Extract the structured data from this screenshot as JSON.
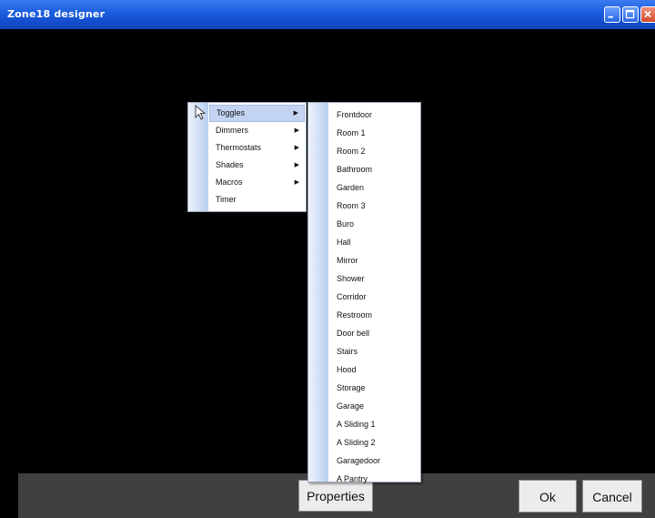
{
  "window": {
    "title": "Zone18 designer"
  },
  "menu1": {
    "items": [
      {
        "label": "Toggles",
        "submenu": true,
        "highlighted": true
      },
      {
        "label": "Dimmers",
        "submenu": true
      },
      {
        "label": "Thermostats",
        "submenu": true
      },
      {
        "label": "Shades",
        "submenu": true
      },
      {
        "label": "Macros",
        "submenu": true
      },
      {
        "label": "Timer",
        "submenu": false
      }
    ]
  },
  "submenu": {
    "items": [
      "Frontdoor",
      "Room 1",
      "Room 2",
      "Bathroom",
      "Garden",
      "Room 3",
      "Buro",
      "Hall",
      "Mirror",
      "Shower",
      "Corridor",
      "Restroom",
      "Door bell",
      "Stairs",
      "Hood",
      "Storage",
      "Garage",
      "A Sliding 1",
      "A Sliding 2",
      "Garagedoor",
      "A Pantry"
    ]
  },
  "buttons": {
    "properties": "Properties",
    "ok": "Ok",
    "cancel": "Cancel"
  },
  "icons": {
    "minimize": "minimize-icon",
    "maximize": "maximize-icon",
    "close": "close-icon",
    "submenu_arrow": "triangle-right-icon",
    "cursor": "mouse-pointer-icon"
  },
  "colors": {
    "titlebar": "#1d5fe0",
    "canvas": "#000000",
    "bottombar": "#404040",
    "menu_highlight": "#c3d4f2"
  }
}
